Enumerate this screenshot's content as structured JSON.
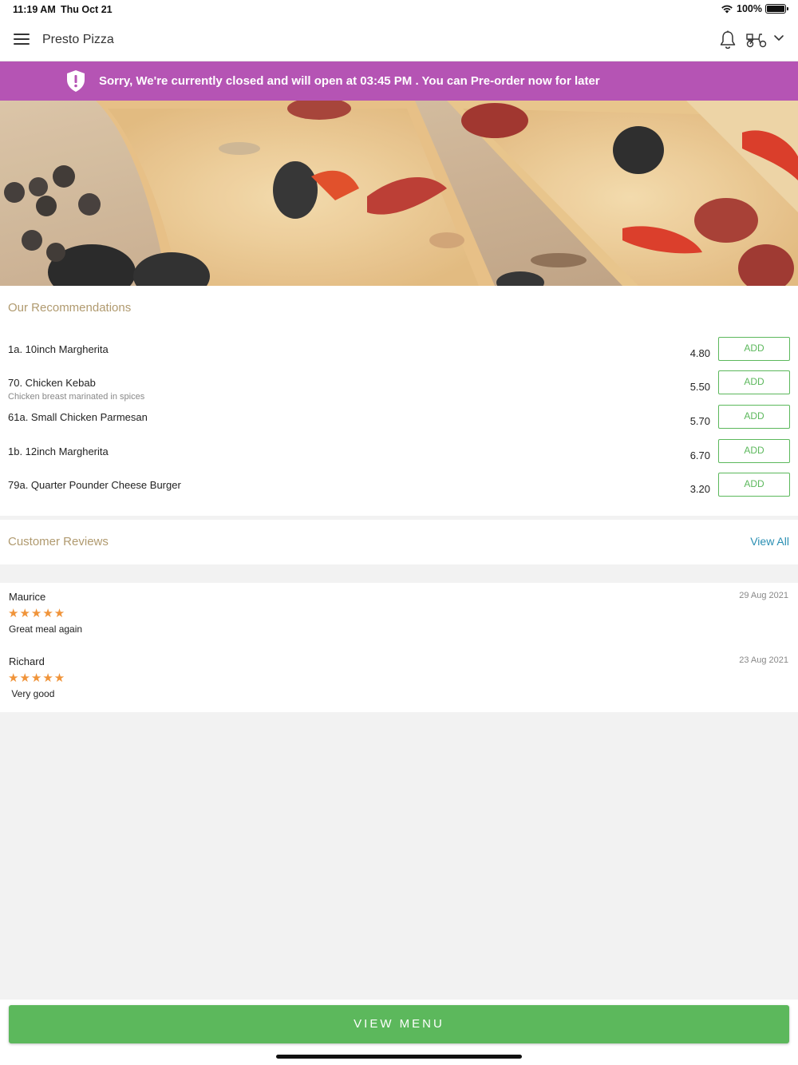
{
  "status_bar": {
    "time": "11:19 AM",
    "date": "Thu Oct 21",
    "battery": "100%",
    "battery_level": 1.0
  },
  "header": {
    "title": "Presto Pizza",
    "icons": [
      "menu-icon",
      "bell-icon",
      "delivery-scooter-icon",
      "chevron-down-icon"
    ]
  },
  "banner": {
    "text": "Sorry, We're currently closed and will open at 03:45 PM . You can Pre-order now for later",
    "color": "#b554b4",
    "icon": "shield-alert-icon"
  },
  "recommendations": {
    "title": "Our Recommendations",
    "add_label": "ADD",
    "items": [
      {
        "name": "1a. 10inch Margherita",
        "description": "",
        "price": "4.80",
        "add": "ADD"
      },
      {
        "name": "70. Chicken Kebab",
        "description": "Chicken breast marinated in spices",
        "price": "5.50",
        "add": "ADD"
      },
      {
        "name": "61a. Small Chicken Parmesan",
        "description": "",
        "price": "5.70",
        "add": "ADD"
      },
      {
        "name": "1b. 12inch Margherita",
        "description": "",
        "price": "6.70",
        "add": "ADD"
      },
      {
        "name": "79a. Quarter Pounder Cheese Burger",
        "description": "",
        "price": "3.20",
        "add": "ADD"
      }
    ]
  },
  "reviews": {
    "title": "Customer Reviews",
    "view_all": "View All",
    "items": [
      {
        "name": "Maurice",
        "date": "29 Aug 2021",
        "rating": 5,
        "stars": "★★★★★",
        "text": "Great meal again"
      },
      {
        "name": "Richard",
        "date": "23 Aug 2021",
        "rating": 5,
        "stars": "★★★★★",
        "text": " Very good"
      }
    ]
  },
  "footer": {
    "view_menu": "VIEW MENU"
  },
  "colors": {
    "accent_green": "#5cb85c",
    "section_title": "#b09a6f",
    "link_blue": "#2a8fb3",
    "star": "#f0943a"
  }
}
